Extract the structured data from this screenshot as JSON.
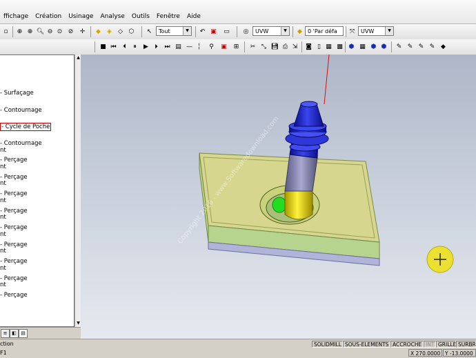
{
  "menu": [
    "ffichage",
    "Création",
    "Usinage",
    "Analyse",
    "Outils",
    "Fenêtre",
    "Aide"
  ],
  "toolbar1": {
    "filter_value": "Tout",
    "frame1_value": "UVW",
    "plane_value": "0 'Par défa",
    "frame2_value": "UVW"
  },
  "tree": {
    "items": [
      "- Surfaçage",
      "- Contournage",
      "- Cycle de Poche",
      "- Contournage",
      "nt",
      "- Perçage",
      "nt",
      "- Perçage",
      "nt",
      "- Perçage",
      "nt",
      "- Perçage",
      "nt",
      "- Perçage",
      "nt",
      "- Perçage",
      "nt",
      "- Perçage",
      "nt",
      "- Perçage",
      "nt",
      "- Perçage"
    ]
  },
  "viewport": {
    "watermark": "Copyright 2016 - www.Softwaredownload.com"
  },
  "status": {
    "left1": "ction",
    "left2": "F1",
    "modes": [
      "SOLIDMILL",
      "SOUS-ELEMENTS",
      "ACCROCHE",
      "INT",
      "GRILLE",
      "SURBRI"
    ],
    "x": "X 270.0000",
    "y": "Y -13.0000"
  },
  "colors": {
    "tool_blue": "#1b1fc4",
    "tool_yellow": "#e8d500",
    "stock": "#d8d88a",
    "cursor": "#f0e030"
  }
}
